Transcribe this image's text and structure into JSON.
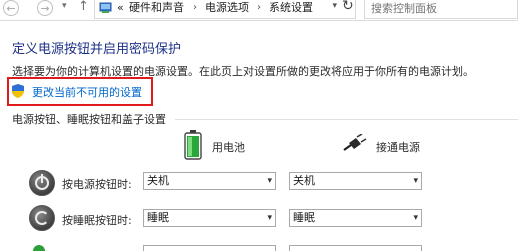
{
  "address_bar": {
    "breadcrumbs": [
      "硬件和声音",
      "电源选项",
      "系统设置"
    ],
    "separator": "›",
    "overflow": "«",
    "search_placeholder": "搜索控制面板"
  },
  "main": {
    "title": "定义电源按钮并启用密码保护",
    "description": "选择要为你的计算机设置的电源设置。在此页上对设置所做的更改将应用于你所有的电源计划。",
    "change_link": "更改当前不可用的设置"
  },
  "section": {
    "title": "电源按钮、睡眠按钮和盖子设置",
    "columns": {
      "battery": "用电池",
      "plugged_in": "接通电源"
    },
    "rows": [
      {
        "label": "按电源按钮时:",
        "battery_value": "关机",
        "plugged_value": "关机"
      },
      {
        "label": "按睡眠按钮时:",
        "battery_value": "睡眠",
        "plugged_value": "睡眠"
      }
    ]
  },
  "colors": {
    "title_blue": "#1e3287",
    "link_blue": "#0066cc",
    "highlight_red": "#e01b1b"
  }
}
